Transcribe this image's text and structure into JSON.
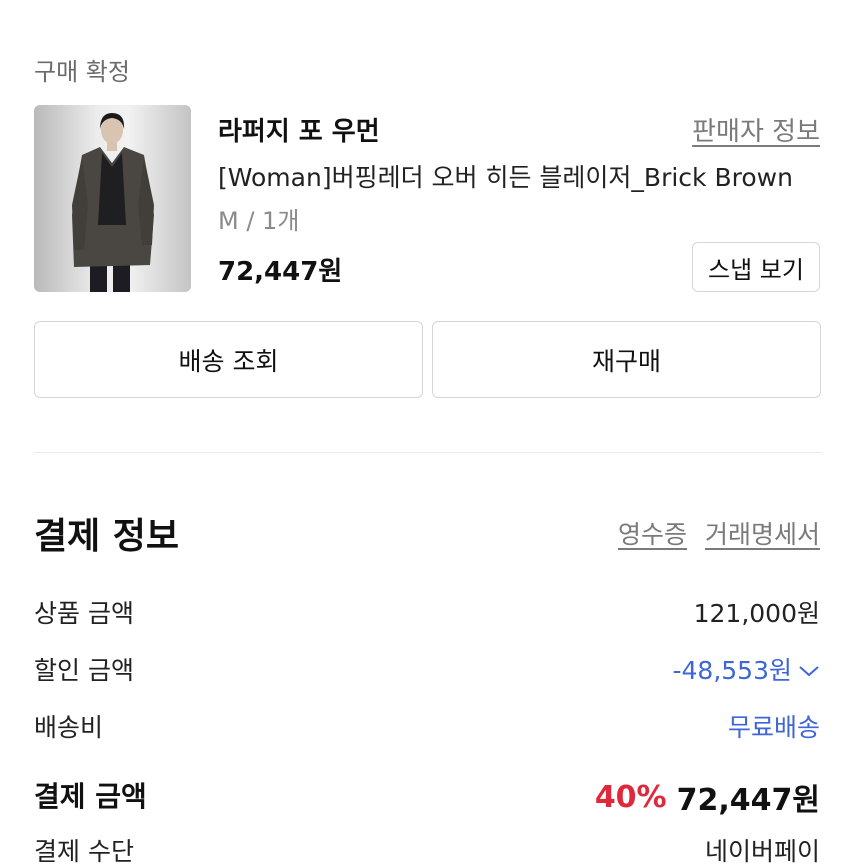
{
  "order": {
    "status": "구매 확정",
    "brand": "라퍼지 포 우먼",
    "seller_info_link": "판매자 정보",
    "product_name": "[Woman]버핑레더 오버 히든 블레이저_Brick Brown",
    "option": "M / 1개",
    "price": "72,447원",
    "snap_button": "스냅 보기",
    "track_button": "배송 조회",
    "rebuy_button": "재구매"
  },
  "payment": {
    "title": "결제 정보",
    "receipt_link": "영수증",
    "statement_link": "거래명세서",
    "rows": [
      {
        "label": "상품 금액",
        "value": "121,000원"
      },
      {
        "label": "할인 금액",
        "value": "-48,553원"
      },
      {
        "label": "배송비",
        "value": "무료배송"
      }
    ],
    "total_label": "결제 금액",
    "discount_percent": "40%",
    "total_value": "72,447원",
    "method_label": "결제 수단",
    "method_value": "네이버페이"
  },
  "colors": {
    "accent_blue": "#3f66d6",
    "discount_red": "#e0283c",
    "muted_gray": "#7a7a7a"
  },
  "icons": {
    "discount_toggle": "chevron-down-icon"
  }
}
